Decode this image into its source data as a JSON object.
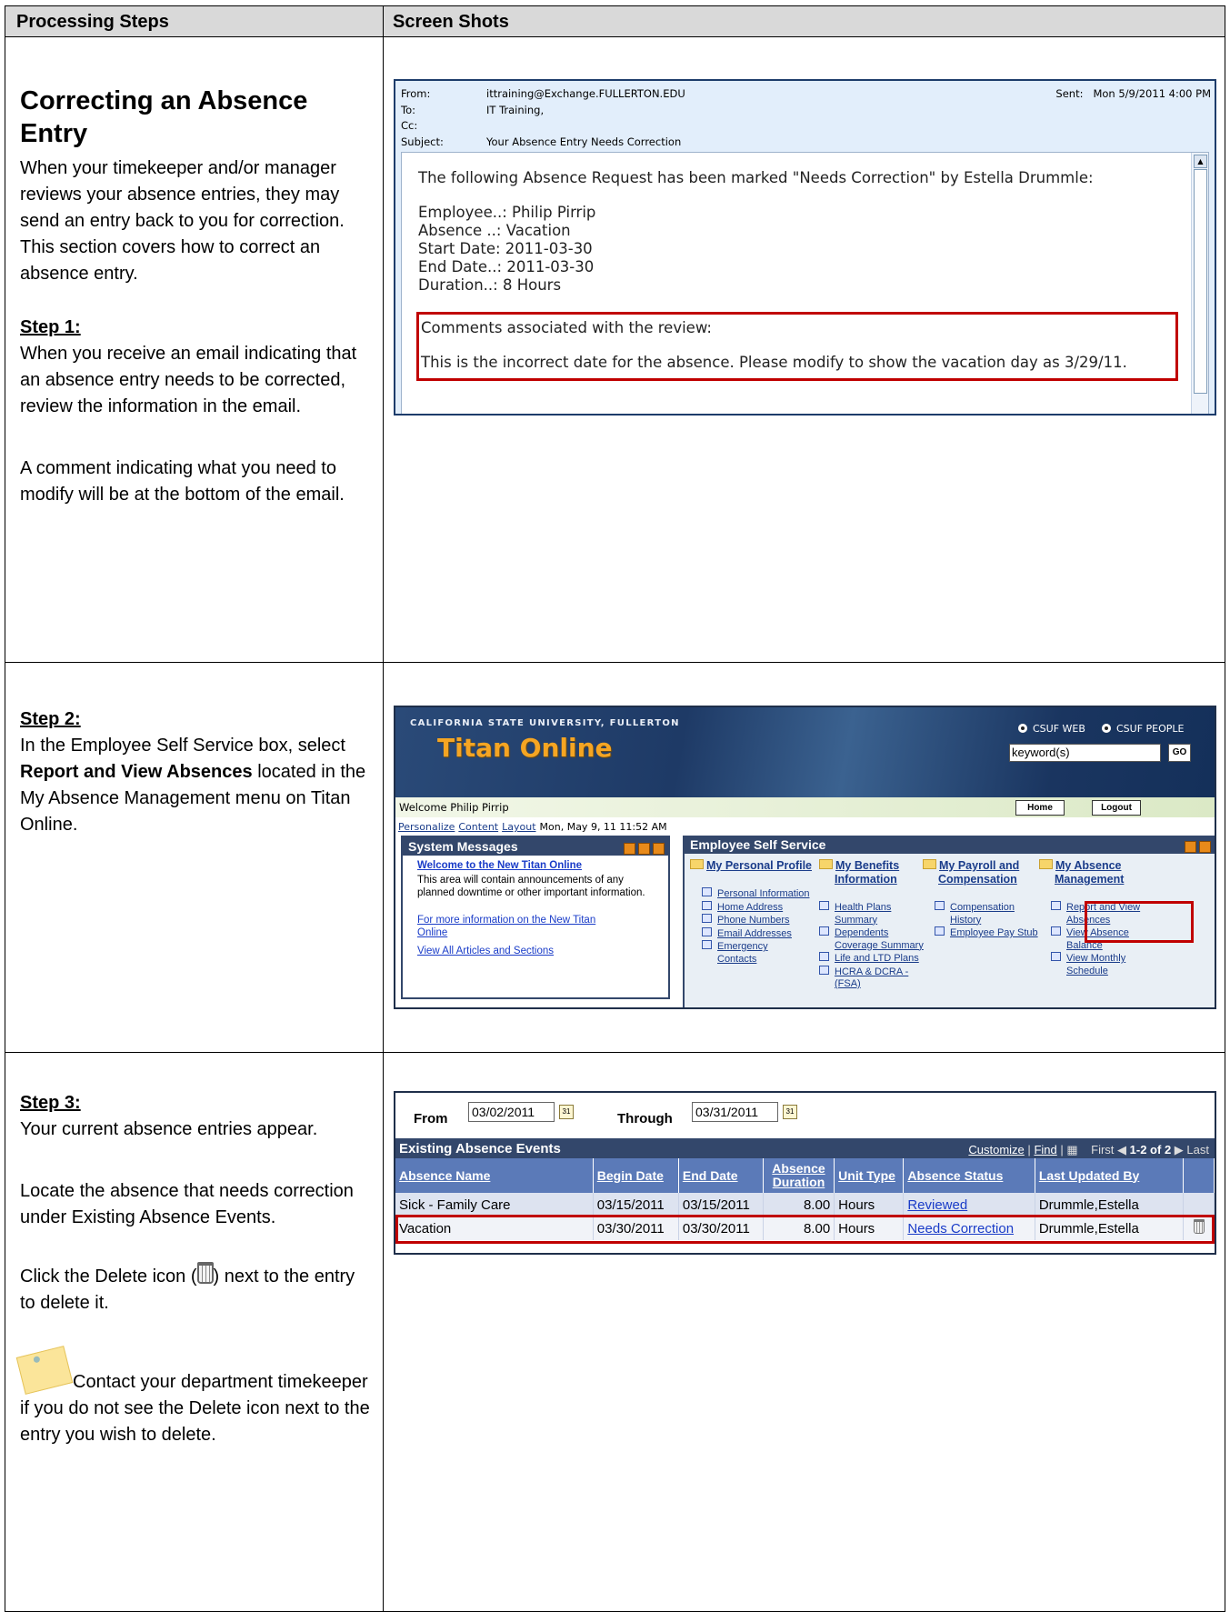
{
  "header": {
    "col1": "Processing Steps",
    "col2": "Screen Shots"
  },
  "section1": {
    "title": "Correcting an Absence Entry",
    "intro": "When your timekeeper and/or manager reviews your absence entries, they may send an entry back to you for correction. This section covers how to correct an absence entry.",
    "step_label": "Step 1:",
    "step_text": "When you receive an email indicating that an absence entry needs to be corrected, review the information in the email.",
    "comment_text": "A comment indicating what you need to modify will be at the bottom of the email."
  },
  "email": {
    "from_label": "From:",
    "from": "ittraining@Exchange.FULLERTON.EDU",
    "sent_label": "Sent:",
    "sent": "Mon 5/9/2011 4:00 PM",
    "to_label": "To:",
    "to": "IT Training,",
    "cc_label": "Cc:",
    "subject_label": "Subject:",
    "subject": "Your Absence Entry Needs Correction",
    "line1": "The following Absence Request has been marked \"Needs Correction\"  by Estella Drummle:",
    "employee": "Employee..: Philip Pirrip",
    "absence": "Absence ..: Vacation",
    "start": "Start Date: 2011-03-30",
    "end": "End Date..: 2011-03-30",
    "duration": "Duration..: 8 Hours",
    "comments_label": "Comments associated with the review:",
    "comment": "This is the incorrect date for the absence. Please modify to show the vacation day as 3/29/11."
  },
  "section2": {
    "step_label": "Step 2:",
    "text_before": "In the Employee Self Service box, select ",
    "text_bold": "Report and View Absences",
    "text_after": " located in the My Absence Management menu on Titan Online."
  },
  "titan": {
    "university": "CALIFORNIA STATE UNIVERSITY, FULLERTON",
    "logo": "Titan Online",
    "radio1": "CSUF WEB",
    "radio2": "CSUF PEOPLE",
    "keyword": "keyword(s)",
    "go": "GO",
    "welcome": "Welcome Philip Pirrip",
    "home": "Home",
    "logout": "Logout",
    "personalize": "Personalize",
    "content": "Content",
    "layout": "Layout",
    "datetime": "Mon, May 9, 11 11:52 AM",
    "sys_title": "System Messages",
    "sys_link1": "Welcome to the New Titan Online",
    "sys_text": "This area will contain announcements of any planned downtime or other important information.",
    "sys_link2": "For more information on the New Titan Online",
    "sys_link3": "View All Articles and Sections",
    "ess_title": "Employee Self Service",
    "col1_title": "My Personal Profile",
    "col1_items": [
      "Personal Information",
      "Home Address",
      "Phone Numbers",
      "Email Addresses",
      "Emergency",
      "Contacts"
    ],
    "col2_title1": "My Benefits",
    "col2_title2": "Information",
    "col2_items": [
      "Health Plans",
      "Summary",
      "Dependents",
      "Coverage Summary",
      "Life and LTD Plans",
      "HCRA & DCRA -",
      "(FSA)"
    ],
    "col3_title1": "My Payroll and",
    "col3_title2": "Compensation",
    "col3_items": [
      "Compensation",
      "History",
      "Employee Pay Stub"
    ],
    "col4_title1": "My Absence",
    "col4_title2": "Management",
    "col4_items": [
      "Report and View",
      "Absences",
      "View Absence",
      "Balance",
      "View Monthly",
      "Schedule"
    ]
  },
  "section3": {
    "step_label": "Step 3:",
    "text1": "Your current absence entries appear.",
    "text2": "Locate the absence that needs correction under Existing Absence Events.",
    "text3a": "Click the Delete icon (",
    "text3b": ") next to the entry to delete it.",
    "note": "Contact your department timekeeper if you do not see the Delete icon next to the entry you wish to delete."
  },
  "absence": {
    "from_label": "From",
    "from": "03/02/2011",
    "through_label": "Through",
    "through": "03/31/2011",
    "title": "Existing Absence Events",
    "customize": "Customize",
    "find": "Find",
    "sep": "|",
    "first": "First",
    "range": "1-2 of 2",
    "last": "Last",
    "headers": [
      "Absence Name",
      "Begin Date",
      "End Date",
      "Absence Duration",
      "Unit Type",
      "Absence Status",
      "Last Updated By"
    ],
    "rows": [
      [
        "Sick - Family Care",
        "03/15/2011",
        "03/15/2011",
        "8.00",
        "Hours",
        "Reviewed",
        "Drummle,Estella"
      ],
      [
        "Vacation",
        "03/30/2011",
        "03/30/2011",
        "8.00",
        "Hours",
        "Needs Correction",
        "Drummle,Estella"
      ]
    ]
  }
}
